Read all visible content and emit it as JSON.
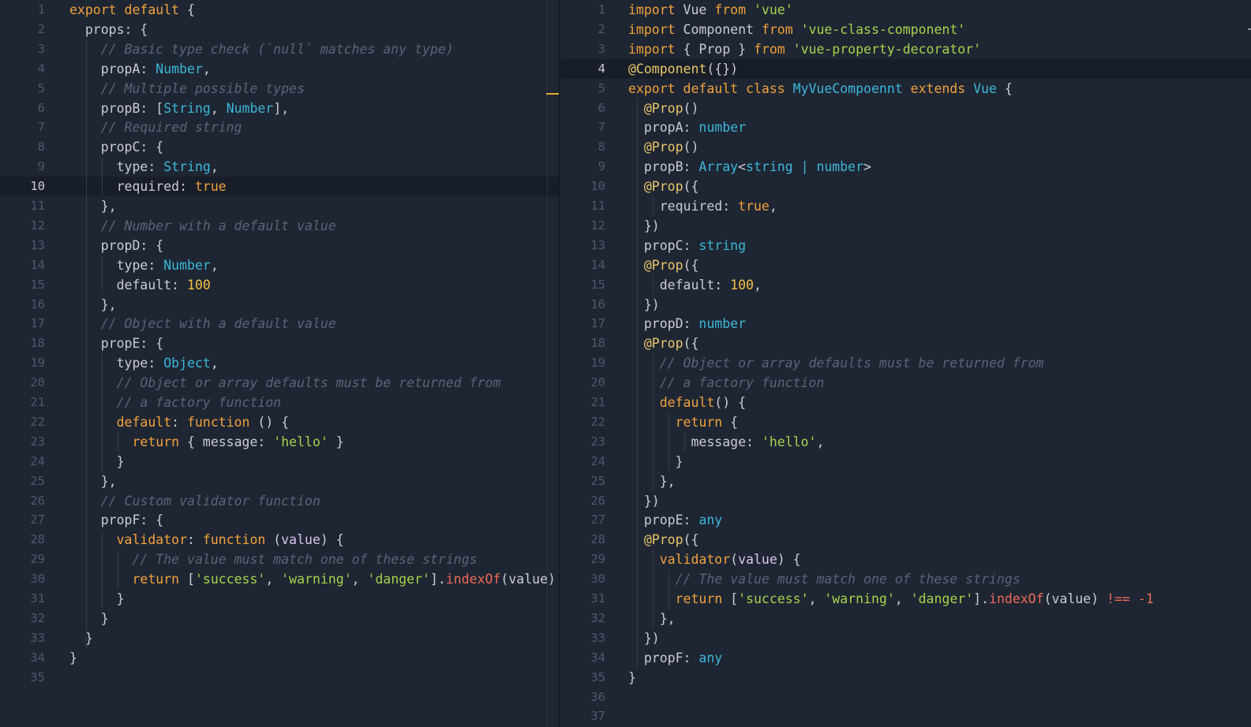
{
  "colors": {
    "background": "#1f2633",
    "keyword": "#f1a23b",
    "type": "#3bb7d9",
    "string": "#a7d24b",
    "number": "#f5c044",
    "comment": "#5a6475",
    "decorator": "#e8c76a",
    "function": "#ee6a55",
    "parameter": "#d8c6ee",
    "plain": "#c9ccd3"
  },
  "left": {
    "active_line": 10,
    "lines": [
      [
        [
          "kw",
          "export default"
        ],
        [
          "pl",
          " {"
        ]
      ],
      [
        [
          "pl",
          "  props: {"
        ]
      ],
      [
        [
          "cmt",
          "    // Basic type check (`null` matches any type)"
        ]
      ],
      [
        [
          "pl",
          "    propA: "
        ],
        [
          "type",
          "Number"
        ],
        [
          "pl",
          ","
        ]
      ],
      [
        [
          "cmt",
          "    // Multiple possible types"
        ]
      ],
      [
        [
          "pl",
          "    propB: ["
        ],
        [
          "type",
          "String"
        ],
        [
          "pl",
          ", "
        ],
        [
          "type",
          "Number"
        ],
        [
          "pl",
          "],"
        ]
      ],
      [
        [
          "cmt",
          "    // Required string"
        ]
      ],
      [
        [
          "pl",
          "    propC: {"
        ]
      ],
      [
        [
          "pl",
          "      type: "
        ],
        [
          "type",
          "String"
        ],
        [
          "pl",
          ","
        ]
      ],
      [
        [
          "pl",
          "      required: "
        ],
        [
          "kw",
          "true"
        ]
      ],
      [
        [
          "pl",
          "    },"
        ]
      ],
      [
        [
          "cmt",
          "    // Number with a default value"
        ]
      ],
      [
        [
          "pl",
          "    propD: {"
        ]
      ],
      [
        [
          "pl",
          "      type: "
        ],
        [
          "type",
          "Number"
        ],
        [
          "pl",
          ","
        ]
      ],
      [
        [
          "pl",
          "      default: "
        ],
        [
          "num",
          "100"
        ]
      ],
      [
        [
          "pl",
          "    },"
        ]
      ],
      [
        [
          "cmt",
          "    // Object with a default value"
        ]
      ],
      [
        [
          "pl",
          "    propE: {"
        ]
      ],
      [
        [
          "pl",
          "      type: "
        ],
        [
          "type",
          "Object"
        ],
        [
          "pl",
          ","
        ]
      ],
      [
        [
          "cmt",
          "      // Object or array defaults must be returned from"
        ]
      ],
      [
        [
          "cmt",
          "      // a factory function"
        ]
      ],
      [
        [
          "prop",
          "      default"
        ],
        [
          "pl",
          ": "
        ],
        [
          "kw",
          "function"
        ],
        [
          "pl",
          " () {"
        ]
      ],
      [
        [
          "kw",
          "        return"
        ],
        [
          "pl",
          " { message: "
        ],
        [
          "str",
          "'hello'"
        ],
        [
          "pl",
          " }"
        ]
      ],
      [
        [
          "pl",
          "      }"
        ]
      ],
      [
        [
          "pl",
          "    },"
        ]
      ],
      [
        [
          "cmt",
          "    // Custom validator function"
        ]
      ],
      [
        [
          "pl",
          "    propF: {"
        ]
      ],
      [
        [
          "prop",
          "      validator"
        ],
        [
          "pl",
          ": "
        ],
        [
          "kw",
          "function"
        ],
        [
          "pl",
          " ("
        ],
        [
          "param",
          "value"
        ],
        [
          "pl",
          ") {"
        ]
      ],
      [
        [
          "cmt",
          "        // The value must match one of these strings"
        ]
      ],
      [
        [
          "kw",
          "        return"
        ],
        [
          "pl",
          " ["
        ],
        [
          "str",
          "'success'"
        ],
        [
          "pl",
          ", "
        ],
        [
          "str",
          "'warning'"
        ],
        [
          "pl",
          ", "
        ],
        [
          "str",
          "'danger'"
        ],
        [
          "pl",
          "]."
        ],
        [
          "fn",
          "indexOf"
        ],
        [
          "pl",
          "(value)"
        ]
      ],
      [
        [
          "pl",
          "      }"
        ]
      ],
      [
        [
          "pl",
          "    }"
        ]
      ],
      [
        [
          "pl",
          "  }"
        ]
      ],
      [
        [
          "pl",
          "}"
        ]
      ],
      []
    ]
  },
  "right": {
    "active_line": 4,
    "lines": [
      [
        [
          "kw",
          "import"
        ],
        [
          "pl",
          " Vue "
        ],
        [
          "kw",
          "from"
        ],
        [
          "pl",
          " "
        ],
        [
          "str",
          "'vue'"
        ]
      ],
      [
        [
          "kw",
          "import"
        ],
        [
          "pl",
          " Component "
        ],
        [
          "kw",
          "from"
        ],
        [
          "pl",
          " "
        ],
        [
          "str",
          "'vue-class-component'"
        ]
      ],
      [
        [
          "kw",
          "import"
        ],
        [
          "pl",
          " { Prop } "
        ],
        [
          "kw",
          "from"
        ],
        [
          "pl",
          " "
        ],
        [
          "str",
          "'vue-property-decorator'"
        ]
      ],
      [
        [
          "deco",
          "@Component"
        ],
        [
          "pl",
          "({})"
        ]
      ],
      [
        [
          "kw",
          "export default class"
        ],
        [
          "pl",
          " "
        ],
        [
          "type",
          "MyVueCompoennt"
        ],
        [
          "pl",
          " "
        ],
        [
          "kw",
          "extends"
        ],
        [
          "pl",
          " "
        ],
        [
          "type",
          "Vue"
        ],
        [
          "pl",
          " {"
        ]
      ],
      [
        [
          "deco",
          "  @Prop"
        ],
        [
          "pl",
          "()"
        ]
      ],
      [
        [
          "pl",
          "  propA: "
        ],
        [
          "type",
          "number"
        ]
      ],
      [
        [
          "deco",
          "  @Prop"
        ],
        [
          "pl",
          "()"
        ]
      ],
      [
        [
          "pl",
          "  propB: "
        ],
        [
          "type",
          "Array"
        ],
        [
          "pl",
          "<"
        ],
        [
          "type",
          "string"
        ],
        [
          "pl",
          " "
        ],
        [
          "type",
          "|"
        ],
        [
          "pl",
          " "
        ],
        [
          "type",
          "number"
        ],
        [
          "pl",
          ">"
        ]
      ],
      [
        [
          "deco",
          "  @Prop"
        ],
        [
          "pl",
          "({"
        ]
      ],
      [
        [
          "pl",
          "    required: "
        ],
        [
          "kw",
          "true"
        ],
        [
          "pl",
          ","
        ]
      ],
      [
        [
          "pl",
          "  })"
        ]
      ],
      [
        [
          "pl",
          "  propC: "
        ],
        [
          "type",
          "string"
        ]
      ],
      [
        [
          "deco",
          "  @Prop"
        ],
        [
          "pl",
          "({"
        ]
      ],
      [
        [
          "pl",
          "    default: "
        ],
        [
          "num",
          "100"
        ],
        [
          "pl",
          ","
        ]
      ],
      [
        [
          "pl",
          "  })"
        ]
      ],
      [
        [
          "pl",
          "  propD: "
        ],
        [
          "type",
          "number"
        ]
      ],
      [
        [
          "deco",
          "  @Prop"
        ],
        [
          "pl",
          "({"
        ]
      ],
      [
        [
          "cmt",
          "    // Object or array defaults must be returned from"
        ]
      ],
      [
        [
          "cmt",
          "    // a factory function"
        ]
      ],
      [
        [
          "prop",
          "    default"
        ],
        [
          "pl",
          "() {"
        ]
      ],
      [
        [
          "kw",
          "      return"
        ],
        [
          "pl",
          " {"
        ]
      ],
      [
        [
          "pl",
          "        message: "
        ],
        [
          "str",
          "'hello'"
        ],
        [
          "pl",
          ","
        ]
      ],
      [
        [
          "pl",
          "      }"
        ]
      ],
      [
        [
          "pl",
          "    },"
        ]
      ],
      [
        [
          "pl",
          "  })"
        ]
      ],
      [
        [
          "pl",
          "  propE: "
        ],
        [
          "type",
          "any"
        ]
      ],
      [
        [
          "deco",
          "  @Prop"
        ],
        [
          "pl",
          "({"
        ]
      ],
      [
        [
          "prop",
          "    validator"
        ],
        [
          "pl",
          "("
        ],
        [
          "param",
          "value"
        ],
        [
          "pl",
          ") {"
        ]
      ],
      [
        [
          "cmt",
          "      // The value must match one of these strings"
        ]
      ],
      [
        [
          "kw",
          "      return"
        ],
        [
          "pl",
          " ["
        ],
        [
          "str",
          "'success'"
        ],
        [
          "pl",
          ", "
        ],
        [
          "str",
          "'warning'"
        ],
        [
          "pl",
          ", "
        ],
        [
          "str",
          "'danger'"
        ],
        [
          "pl",
          "]."
        ],
        [
          "fn",
          "indexOf"
        ],
        [
          "pl",
          "(value) "
        ],
        [
          "op",
          "!=="
        ],
        [
          "pl",
          " "
        ],
        [
          "op",
          "-1"
        ]
      ],
      [
        [
          "pl",
          "    },"
        ]
      ],
      [
        [
          "pl",
          "  })"
        ]
      ],
      [
        [
          "pl",
          "  propF: "
        ],
        [
          "type",
          "any"
        ]
      ],
      [
        [
          "pl",
          "}"
        ]
      ],
      [],
      []
    ]
  }
}
